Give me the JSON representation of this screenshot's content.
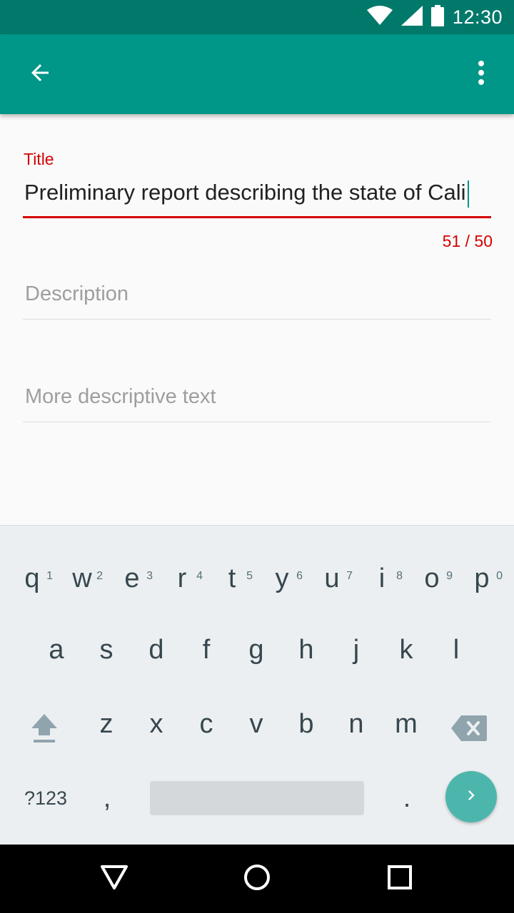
{
  "status_bar": {
    "time": "12:30",
    "icons": [
      "wifi-icon",
      "cellular-signal-icon",
      "battery-icon"
    ]
  },
  "app_bar": {
    "back_icon": "arrow-back-icon",
    "menu_icon": "more-vert-icon"
  },
  "form": {
    "title_label": "Title",
    "title_value": "Preliminary report describing the state of Cali",
    "counter": "51 / 50",
    "description_placeholder": "Description",
    "more_placeholder": "More descriptive text"
  },
  "keyboard": {
    "row1": [
      {
        "key": "q",
        "hint": "1"
      },
      {
        "key": "w",
        "hint": "2"
      },
      {
        "key": "e",
        "hint": "3"
      },
      {
        "key": "r",
        "hint": "4"
      },
      {
        "key": "t",
        "hint": "5"
      },
      {
        "key": "y",
        "hint": "6"
      },
      {
        "key": "u",
        "hint": "7"
      },
      {
        "key": "i",
        "hint": "8"
      },
      {
        "key": "o",
        "hint": "9"
      },
      {
        "key": "p",
        "hint": "0"
      }
    ],
    "row2": [
      "a",
      "s",
      "d",
      "f",
      "g",
      "h",
      "j",
      "k",
      "l"
    ],
    "row3": [
      "z",
      "x",
      "c",
      "v",
      "b",
      "n",
      "m"
    ],
    "symbols": "?123",
    "comma": ",",
    "period": ".",
    "enter_icon": "chevron-right-icon",
    "shift_icon": "shift-icon",
    "delete_icon": "backspace-icon"
  },
  "nav_bar": {
    "icons": [
      "back-triangle-icon",
      "home-circle-icon",
      "recents-square-icon"
    ]
  },
  "colors": {
    "primary": "#009688",
    "primary_dark": "#00796b",
    "error": "#d50000",
    "accent": "#4db6ac"
  }
}
